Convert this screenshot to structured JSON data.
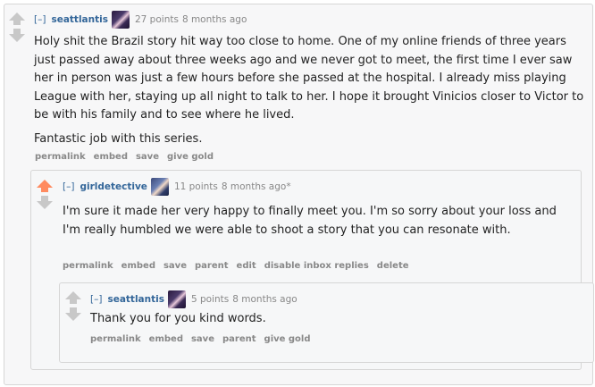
{
  "comments": [
    {
      "expand": "[–]",
      "author": "seattlantis",
      "score": "27 points",
      "time": "8 months ago",
      "paragraphs": [
        "Holy shit the Brazil story hit way too close to home. One of my online friends of three years just passed away about three weeks ago and we never got to meet, the first time I ever saw her in person was just a few hours before she passed at the hospital. I already miss playing League with her, staying up all night to talk to her. I hope it brought Vinicios closer to Victor to be with his family and to see where he lived.",
        "Fantastic job with this series."
      ],
      "buttons": [
        "permalink",
        "embed",
        "save",
        "give gold"
      ]
    },
    {
      "expand": "[–]",
      "author": "girldetective",
      "score": "11 points",
      "time": "8 months ago*",
      "paragraphs": [
        "I'm sure it made her very happy to finally meet you. I'm so sorry about your loss and I'm really humbled we were able to shoot a story that you can resonate with."
      ],
      "buttons": [
        "permalink",
        "embed",
        "save",
        "parent",
        "edit",
        "disable inbox replies",
        "delete"
      ]
    },
    {
      "expand": "[–]",
      "author": "seattlantis",
      "score": "5 points",
      "time": "8 months ago",
      "paragraphs": [
        "Thank you for you kind words."
      ],
      "buttons": [
        "permalink",
        "embed",
        "save",
        "parent",
        "give gold"
      ]
    }
  ],
  "colors": {
    "upvote_active": "#ff8b60",
    "arrow_inactive": "#c8c8c8",
    "link": "#336699"
  },
  "icons": {
    "upvote": "upvote-arrow-icon",
    "downvote": "downvote-arrow-icon"
  }
}
